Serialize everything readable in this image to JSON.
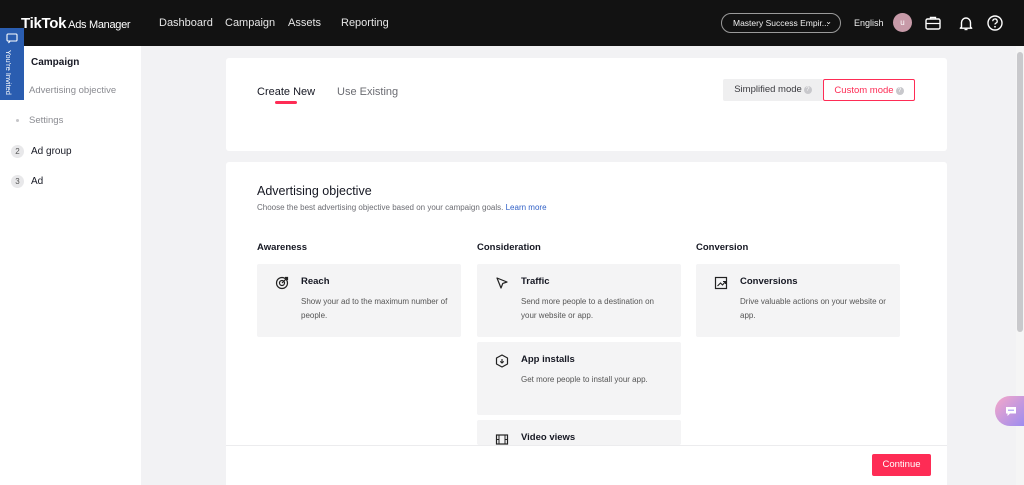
{
  "header": {
    "logo_brand": "TikTok",
    "logo_product": "Ads Manager",
    "nav": [
      "Dashboard",
      "Campaign",
      "Assets",
      "Reporting"
    ],
    "account": "Mastery Success Empir...",
    "language": "English",
    "avatar_initial": "u"
  },
  "invited_tab": "You're Invited",
  "sidebar": {
    "campaign": "Campaign",
    "sub_objective": "Advertising objective",
    "sub_settings": "Settings",
    "adgroup_num": "2",
    "adgroup": "Ad group",
    "ad_num": "3",
    "ad": "Ad"
  },
  "tabs": {
    "create_new": "Create New",
    "use_existing": "Use Existing"
  },
  "modes": {
    "simplified": "Simplified mode",
    "custom": "Custom mode"
  },
  "objective": {
    "title": "Advertising objective",
    "description": "Choose the best advertising objective based on your campaign goals.",
    "learn_more": "Learn more",
    "columns": [
      "Awareness",
      "Consideration",
      "Conversion"
    ],
    "cards": {
      "reach": {
        "title": "Reach",
        "desc": "Show your ad to the maximum number of people."
      },
      "traffic": {
        "title": "Traffic",
        "desc": "Send more people to a destination on your website or app."
      },
      "app_installs": {
        "title": "App installs",
        "desc": "Get more people to install your app."
      },
      "video_views": {
        "title": "Video views",
        "desc": ""
      },
      "conversions": {
        "title": "Conversions",
        "desc": "Drive valuable actions on your website or app."
      }
    }
  },
  "footer": {
    "continue": "Continue"
  },
  "colors": {
    "accent": "#fe2c55",
    "topbar": "#121212",
    "link": "#2f5fc6",
    "invite_tab": "#2a5db0"
  }
}
